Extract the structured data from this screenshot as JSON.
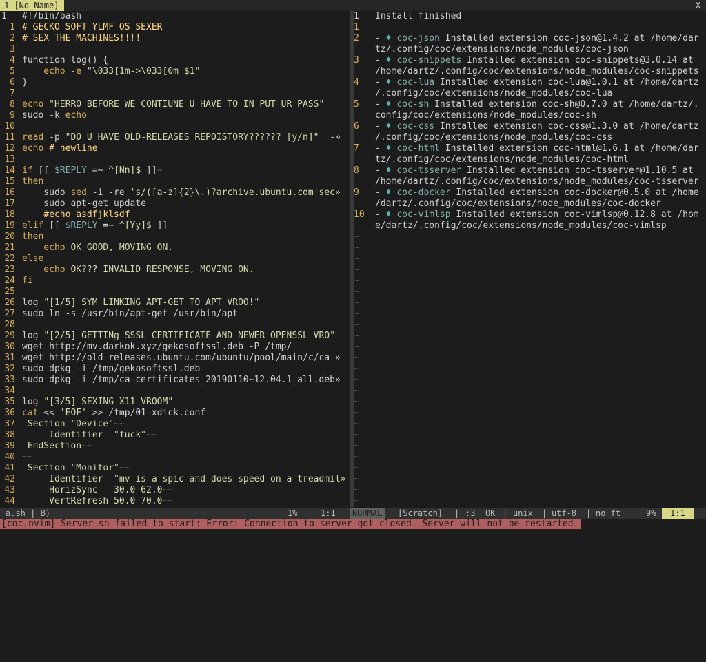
{
  "tabline": {
    "active_tab": "1 [No Name]",
    "close": "X"
  },
  "left_pane": {
    "lines": [
      {
        "n": "1",
        "segs": [
          [
            "",
            "#!/bin/bash"
          ]
        ],
        "current": true
      },
      {
        "n": "1",
        "segs": [
          [
            "cmt",
            "# GECKO SOFT YLMF OS SEXER"
          ]
        ]
      },
      {
        "n": "2",
        "segs": [
          [
            "cmt",
            "# SEX THE MACHINES!!!!"
          ]
        ]
      },
      {
        "n": "3",
        "segs": []
      },
      {
        "n": "4",
        "segs": [
          [
            "",
            "function log() {"
          ]
        ]
      },
      {
        "n": "5",
        "segs": [
          [
            "kw",
            "    echo"
          ],
          [
            "kw",
            " -e "
          ],
          [
            "str",
            "\"\\033[1m->\\033[0m $1\""
          ]
        ]
      },
      {
        "n": "6",
        "segs": [
          [
            "",
            "}"
          ]
        ]
      },
      {
        "n": "7",
        "segs": []
      },
      {
        "n": "8",
        "segs": [
          [
            "kw",
            "echo "
          ],
          [
            "str",
            "\"HERRO BEFORE WE CONTIUNE U HAVE TO IN PUT UR PASS\""
          ]
        ]
      },
      {
        "n": "9",
        "segs": [
          [
            "",
            "sudo -k "
          ],
          [
            "kw",
            "echo"
          ]
        ]
      },
      {
        "n": "10",
        "segs": []
      },
      {
        "n": "11",
        "segs": [
          [
            "kw",
            "read"
          ],
          [
            "",
            " -p "
          ],
          [
            "str",
            "\"DO U HAVE OLD-RELEASES REPOISTORY?????? [y/n]\""
          ],
          [
            "",
            "  -»"
          ]
        ]
      },
      {
        "n": "12",
        "segs": [
          [
            "kw",
            "echo"
          ],
          [
            "cmt",
            " # newline"
          ]
        ]
      },
      {
        "n": "13",
        "segs": []
      },
      {
        "n": "14",
        "segs": [
          [
            "kw",
            "if"
          ],
          [
            "",
            " [[ "
          ],
          [
            "var",
            "$REPLY"
          ],
          [
            "",
            " =~ "
          ],
          [
            "str",
            "^[Nn]$"
          ],
          [
            "",
            " ]]"
          ],
          [
            "tilde",
            "~"
          ]
        ]
      },
      {
        "n": "15",
        "segs": [
          [
            "kw",
            "then"
          ]
        ]
      },
      {
        "n": "16",
        "segs": [
          [
            "",
            "    sudo "
          ],
          [
            "kw",
            "sed"
          ],
          [
            "",
            " -i -re "
          ],
          [
            "str",
            "'s/([a-z]{2}\\.)?archive.ubuntu.com|sec»"
          ]
        ]
      },
      {
        "n": "17",
        "segs": [
          [
            "",
            "    sudo apt-get update"
          ]
        ]
      },
      {
        "n": "18",
        "segs": [
          [
            "cmt",
            "    #echo asdfjklsdf"
          ]
        ]
      },
      {
        "n": "19",
        "segs": [
          [
            "kw",
            "elif"
          ],
          [
            "",
            " [[ "
          ],
          [
            "var",
            "$REPLY"
          ],
          [
            "",
            " =~ "
          ],
          [
            "str",
            "^[Yy]$"
          ],
          [
            "",
            " ]]"
          ]
        ]
      },
      {
        "n": "20",
        "segs": [
          [
            "kw",
            "then"
          ]
        ]
      },
      {
        "n": "21",
        "segs": [
          [
            "kw",
            "    echo"
          ],
          [
            "str",
            " OK GOOD, MOVING ON."
          ]
        ]
      },
      {
        "n": "22",
        "segs": [
          [
            "kw",
            "else"
          ]
        ]
      },
      {
        "n": "23",
        "segs": [
          [
            "kw",
            "    echo"
          ],
          [
            "str",
            " OK??? INVALID RESPONSE, MOVING ON."
          ]
        ]
      },
      {
        "n": "24",
        "segs": [
          [
            "kw",
            "fi"
          ]
        ]
      },
      {
        "n": "25",
        "segs": []
      },
      {
        "n": "26",
        "segs": [
          [
            "",
            "log "
          ],
          [
            "str",
            "\"[1/5] SYM LINKING APT-GET TO APT VROO!\""
          ]
        ]
      },
      {
        "n": "27",
        "segs": [
          [
            "",
            "sudo ln -s /usr/bin/apt-get /usr/bin/apt"
          ]
        ]
      },
      {
        "n": "28",
        "segs": []
      },
      {
        "n": "29",
        "segs": [
          [
            "",
            "log "
          ],
          [
            "str",
            "\"[2/5] GETTINg SSSL CERTIFICATE AND NEWER OPENSSL VRO\""
          ]
        ]
      },
      {
        "n": "30",
        "segs": [
          [
            "",
            "wget http://mv.darkok.xyz/gekosoftssl.deb -P /tmp/"
          ]
        ]
      },
      {
        "n": "31",
        "segs": [
          [
            "",
            "wget http://old-releases.ubuntu.com/ubuntu/pool/main/c/ca-»"
          ]
        ]
      },
      {
        "n": "32",
        "segs": [
          [
            "",
            "sudo dpkg -i /tmp/gekosoftssl.deb"
          ]
        ]
      },
      {
        "n": "33",
        "segs": [
          [
            "",
            "sudo dpkg -i /tmp/ca-certificates_20190110~12.04.1_all.deb»"
          ]
        ]
      },
      {
        "n": "34",
        "segs": []
      },
      {
        "n": "35",
        "segs": [
          [
            "",
            "log "
          ],
          [
            "str",
            "\"[3/5] SEXING X11 VROOM\""
          ]
        ]
      },
      {
        "n": "36",
        "segs": [
          [
            "kw",
            "cat"
          ],
          [
            "",
            " << "
          ],
          [
            "str",
            "'EOF'"
          ],
          [
            "",
            " >> /tmp/01-xdick.conf"
          ]
        ]
      },
      {
        "n": "37",
        "segs": [
          [
            "str",
            " Section \"Device\""
          ],
          [
            "tilde",
            "~~"
          ]
        ]
      },
      {
        "n": "38",
        "segs": [
          [
            "str",
            "     Identifier  \"fuck\""
          ],
          [
            "tilde",
            "~~"
          ]
        ]
      },
      {
        "n": "39",
        "segs": [
          [
            "str",
            " EndSection"
          ],
          [
            "tilde",
            "~~"
          ]
        ]
      },
      {
        "n": "40",
        "segs": [
          [
            "tilde",
            "~~"
          ]
        ]
      },
      {
        "n": "41",
        "segs": [
          [
            "str",
            " Section \"Monitor\""
          ],
          [
            "tilde",
            "~~"
          ]
        ]
      },
      {
        "n": "42",
        "segs": [
          [
            "str",
            "     Identifier  \"mv is a spic and does speed on a treadmil»"
          ]
        ]
      },
      {
        "n": "43",
        "segs": [
          [
            "str",
            "     HorizSync   30.0-62.0"
          ],
          [
            "tilde",
            "~~"
          ]
        ]
      },
      {
        "n": "44",
        "segs": [
          [
            "str",
            "     VertRefresh 50.0-70.0"
          ],
          [
            "tilde",
            "~~"
          ]
        ]
      }
    ]
  },
  "right_pane": {
    "lines": [
      {
        "n": "1",
        "segs": [
          [
            "",
            "Install finished"
          ]
        ],
        "current": true
      },
      {
        "n": "1",
        "segs": []
      },
      {
        "n": "2",
        "segs": [
          [
            "dash",
            "- "
          ],
          [
            "check",
            "♦ "
          ],
          [
            "ext",
            "coc-json"
          ],
          [
            "",
            " Installed extension coc-json@1.4.2 at /home/dar"
          ]
        ]
      },
      {
        "n": "",
        "segs": [
          [
            "",
            "tz/.config/coc/extensions/node_modules/coc-json"
          ]
        ]
      },
      {
        "n": "3",
        "segs": [
          [
            "dash",
            "- "
          ],
          [
            "check",
            "♦ "
          ],
          [
            "ext",
            "coc-snippets"
          ],
          [
            "",
            " Installed extension coc-snippets@3.0.14 at"
          ]
        ]
      },
      {
        "n": "",
        "segs": [
          [
            "",
            "/home/dartz/.config/coc/extensions/node_modules/coc-snippets"
          ]
        ]
      },
      {
        "n": "4",
        "segs": [
          [
            "dash",
            "- "
          ],
          [
            "check",
            "♦ "
          ],
          [
            "ext",
            "coc-lua"
          ],
          [
            "",
            " Installed extension coc-lua@1.0.1 at /home/dartz"
          ]
        ]
      },
      {
        "n": "",
        "segs": [
          [
            "",
            "/.config/coc/extensions/node_modules/coc-lua"
          ]
        ]
      },
      {
        "n": "5",
        "segs": [
          [
            "dash",
            "- "
          ],
          [
            "check",
            "♦ "
          ],
          [
            "ext",
            "coc-sh"
          ],
          [
            "",
            " Installed extension coc-sh@0.7.0 at /home/dartz/."
          ]
        ]
      },
      {
        "n": "",
        "segs": [
          [
            "",
            "config/coc/extensions/node_modules/coc-sh"
          ]
        ]
      },
      {
        "n": "6",
        "segs": [
          [
            "dash",
            "- "
          ],
          [
            "check",
            "♦ "
          ],
          [
            "ext",
            "coc-css"
          ],
          [
            "",
            " Installed extension coc-css@1.3.0 at /home/dartz"
          ]
        ]
      },
      {
        "n": "",
        "segs": [
          [
            "",
            "/.config/coc/extensions/node_modules/coc-css"
          ]
        ]
      },
      {
        "n": "7",
        "segs": [
          [
            "dash",
            "- "
          ],
          [
            "check",
            "♦ "
          ],
          [
            "ext",
            "coc-html"
          ],
          [
            "",
            " Installed extension coc-html@1.6.1 at /home/dar"
          ]
        ]
      },
      {
        "n": "",
        "segs": [
          [
            "",
            "tz/.config/coc/extensions/node_modules/coc-html"
          ]
        ]
      },
      {
        "n": "8",
        "segs": [
          [
            "dash",
            "- "
          ],
          [
            "check",
            "♦ "
          ],
          [
            "ext",
            "coc-tsserver"
          ],
          [
            "",
            " Installed extension coc-tsserver@1.10.5 at"
          ]
        ]
      },
      {
        "n": "",
        "segs": [
          [
            "",
            "/home/dartz/.config/coc/extensions/node_modules/coc-tsserver"
          ]
        ]
      },
      {
        "n": "9",
        "segs": [
          [
            "dash",
            "- "
          ],
          [
            "check",
            "♦ "
          ],
          [
            "ext",
            "coc-docker"
          ],
          [
            "",
            " Installed extension coc-docker@0.5.0 at /home"
          ]
        ]
      },
      {
        "n": "",
        "segs": [
          [
            "",
            "/dartz/.config/coc/extensions/node_modules/coc-docker"
          ]
        ]
      },
      {
        "n": "10",
        "segs": [
          [
            "dash",
            "- "
          ],
          [
            "check",
            "♦ "
          ],
          [
            "ext",
            "coc-vimlsp"
          ],
          [
            "",
            " Installed extension coc-vimlsp@0.12.8 at /hom"
          ]
        ]
      },
      {
        "n": "",
        "segs": [
          [
            "",
            "e/dartz/.config/coc/extensions/node_modules/coc-vimlsp"
          ]
        ]
      }
    ],
    "tilde": "~"
  },
  "status_left": {
    "file": "a.sh | B)",
    "percent": "1%",
    "position": "1:1"
  },
  "status_right": {
    "mode": "NORMAL",
    "buffer": "[Scratch]",
    "sep1": "|",
    "count": ":3",
    "ok": "OK",
    "sep2": "|",
    "format": "unix",
    "sep3": "|",
    "encoding": "utf-8",
    "sep4": "|",
    "filetype": "no ft",
    "percent": "9%",
    "position": "1:1"
  },
  "error_message": "[coc.nvim] Server sh failed to start: Error: Connection to server got closed. Server will not be restarted."
}
